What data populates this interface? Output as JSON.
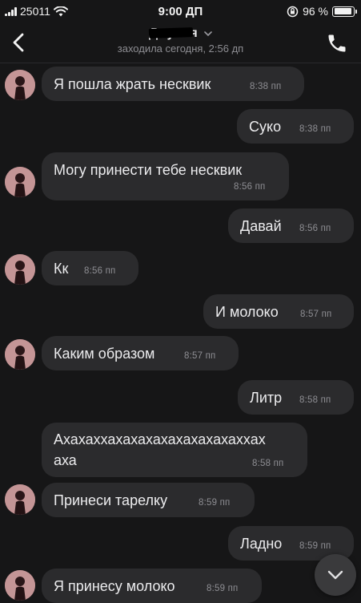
{
  "status_bar": {
    "carrier": "25011",
    "time": "9:00 ДП",
    "battery": "96 %",
    "battery_level": 0.96
  },
  "header": {
    "contact_name": "Джулия",
    "last_seen": "заходила сегодня, 2:56 дп"
  },
  "messages": [
    {
      "side": "in",
      "text": "Я пошла жрать несквик",
      "time": "8:38 пп"
    },
    {
      "side": "out",
      "text": "Суко",
      "time": "8:38 пп"
    },
    {
      "side": "in",
      "text": "Могу принести тебе несквик",
      "time": "8:56 пп"
    },
    {
      "side": "out",
      "text": "Давай",
      "time": "8:56 пп"
    },
    {
      "side": "in",
      "text": "Кк",
      "time": "8:56 пп"
    },
    {
      "side": "out",
      "text": "И молоко",
      "time": "8:57 пп"
    },
    {
      "side": "in",
      "text": "Каким образом",
      "time": "8:57 пп"
    },
    {
      "side": "out",
      "text": "Литр",
      "time": "8:58 пп"
    },
    {
      "side": "in",
      "text_line1": "Ахахаххахахахахахахахахаххах",
      "text_line2": "аха",
      "time": "8:58 пп"
    },
    {
      "side": "in",
      "text": "Принеси тарелку",
      "time": "8:59 пп"
    },
    {
      "side": "out",
      "text": "Ладно",
      "time": "8:59 пп"
    },
    {
      "side": "in",
      "text": "Я принесу молоко",
      "time": "8:59 пп"
    }
  ],
  "icons": {
    "back": "chevron-left-icon",
    "call": "phone-icon",
    "scroll": "chevron-down-icon",
    "wifi": "wifi-icon",
    "lock": "rotation-lock-icon"
  },
  "colors": {
    "background": "#161617",
    "bubble": "#2b2b2d",
    "text": "#ececee",
    "muted": "#8e8e93"
  }
}
